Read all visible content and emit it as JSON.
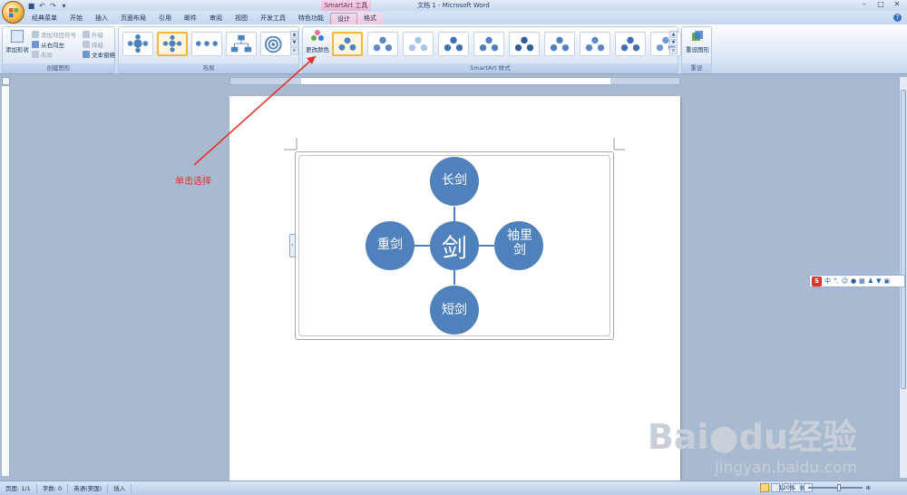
{
  "window": {
    "title": "文档 1 - Microsoft Word",
    "context_group": "SmartArt 工具"
  },
  "tabs": [
    {
      "label": "经典菜单"
    },
    {
      "label": "开始"
    },
    {
      "label": "插入"
    },
    {
      "label": "页面布局"
    },
    {
      "label": "引用"
    },
    {
      "label": "邮件"
    },
    {
      "label": "审阅"
    },
    {
      "label": "视图"
    },
    {
      "label": "开发工具"
    },
    {
      "label": "特色功能"
    },
    {
      "label": "设计"
    },
    {
      "label": "格式"
    }
  ],
  "ribbon": {
    "create_graphic": {
      "label": "创建图形",
      "add_shape": "添加形状",
      "add_bullet": "添加项目符号",
      "right_to_left": "从右向左",
      "layout": "布局",
      "promote": "升级",
      "demote": "降级",
      "text_pane": "文本窗格"
    },
    "layouts": {
      "label": "布局"
    },
    "styles": {
      "label": "SmartArt 样式",
      "change_colors": "更改颜色"
    },
    "reset": {
      "label": "重设",
      "reset_graphic": "重设图形"
    }
  },
  "document": {
    "center": "剑",
    "top": "长剑",
    "left": "重剑",
    "right": "袖里剑",
    "bottom": "短剑"
  },
  "annotation": {
    "callout": "单击选择",
    "color": "#e0342b"
  },
  "watermark": {
    "brand": "Bai",
    "brand_tail": "du",
    "cn": "经验",
    "url": "jingyan.baidu.com"
  },
  "ime": {
    "label": "中"
  },
  "statusbar": {
    "page": "页面: 1/1",
    "words": "字数: 0",
    "language": "英语(美国)",
    "mode": "插入",
    "zoom": "120%"
  },
  "colors": {
    "node_fill": "#4f81bd",
    "accent": "#f4b63f"
  }
}
